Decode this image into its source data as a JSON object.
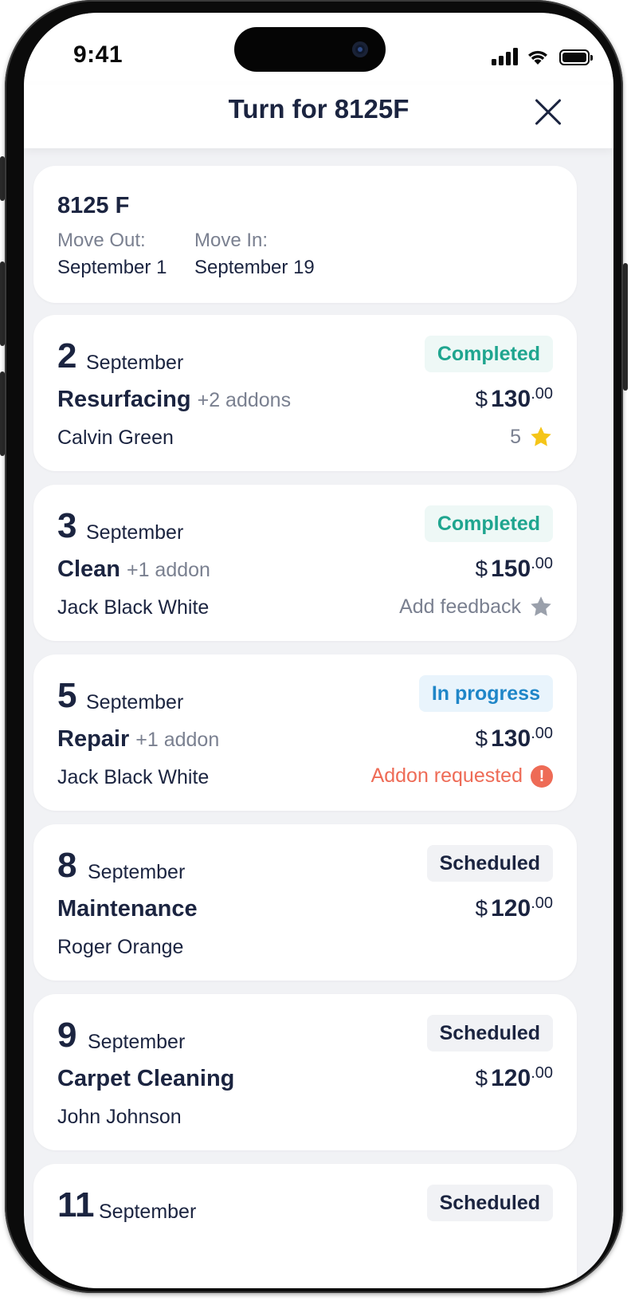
{
  "status_bar": {
    "time": "9:41"
  },
  "header": {
    "title": "Turn for 8125F"
  },
  "unit": {
    "name": "8125 F",
    "move_out_label": "Move Out:",
    "move_out_date": "September 1",
    "move_in_label": "Move In:",
    "move_in_date": "September 19"
  },
  "jobs": [
    {
      "day": "2",
      "month": "September",
      "service": "Resurfacing",
      "addons": "+2 addons",
      "person": "Calvin Green",
      "status": "Completed",
      "currency": "$",
      "price": "130",
      "cents": ".00",
      "meta": "5"
    },
    {
      "day": "3",
      "month": "September",
      "service": "Clean",
      "addons": "+1 addon",
      "person": "Jack Black White",
      "status": "Completed",
      "currency": "$",
      "price": "150",
      "cents": ".00",
      "meta": "Add feedback"
    },
    {
      "day": "5",
      "month": "September",
      "service": "Repair",
      "addons": "+1 addon",
      "person": "Jack Black White",
      "status": "In progress",
      "currency": "$",
      "price": "130",
      "cents": ".00",
      "meta": "Addon requested"
    },
    {
      "day": "8",
      "month": "September",
      "service": "Maintenance",
      "person": "Roger Orange",
      "status": "Scheduled",
      "currency": "$",
      "price": "120",
      "cents": ".00"
    },
    {
      "day": "9",
      "month": "September",
      "service": "Carpet Cleaning",
      "person": "John Johnson",
      "status": "Scheduled",
      "currency": "$",
      "price": "120",
      "cents": ".00"
    },
    {
      "day": "11",
      "month": "September",
      "status": "Scheduled"
    }
  ],
  "colors": {
    "completed": "#1fa58f",
    "in_progress": "#1f86c8",
    "alert": "#ee6b56",
    "star_filled": "#f5c518",
    "star_empty": "#9aa0ab",
    "text_primary": "#1b2440"
  }
}
